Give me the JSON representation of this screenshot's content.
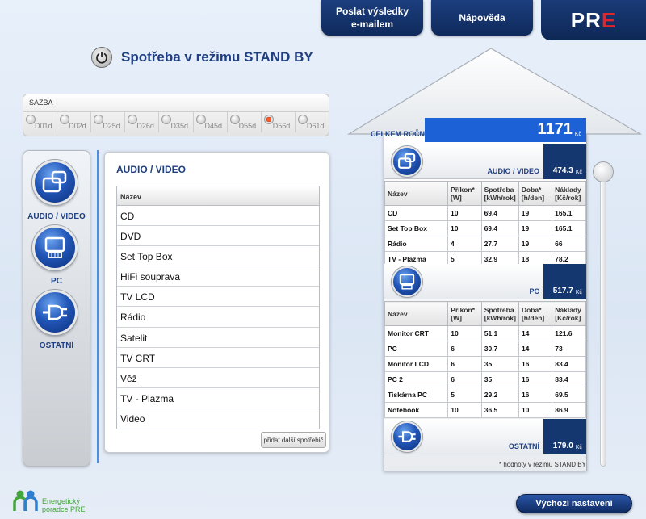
{
  "nav": {
    "email_label": "Poslat výsledky\ne-mailem",
    "help_label": "Nápověda",
    "logo_part1": "PR",
    "logo_part2": "E"
  },
  "header": {
    "title": "Spotřeba v režimu STAND BY"
  },
  "sazba": {
    "label": "SAZBA",
    "options": [
      "D01d",
      "D02d",
      "D25d",
      "D26d",
      "D35d",
      "D45d",
      "D55d",
      "D56d",
      "D61d"
    ],
    "selected": "D56d"
  },
  "categories": [
    {
      "label": "AUDIO / VIDEO",
      "icon": "audio-video-icon"
    },
    {
      "label": "PC",
      "icon": "pc-icon"
    },
    {
      "label": "OSTATNÍ",
      "icon": "plug-icon"
    }
  ],
  "device_panel": {
    "title": "AUDIO / VIDEO",
    "column_header": "Název",
    "items": [
      "CD",
      "DVD",
      "Set Top Box",
      "HiFi souprava",
      "TV LCD",
      "Rádio",
      "Satelit",
      "TV CRT",
      "Věž",
      "TV - Plazma",
      "Video"
    ],
    "add_button": "přidat další spotřebič"
  },
  "house": {
    "total_label": "CELKEM ROČNĚ",
    "total_value": "1171",
    "currency": "Kč",
    "columns": [
      "Název",
      "Příkon*\n[W]",
      "Spotřeba\n[kWh/rok]",
      "Doba*\n[h/den]",
      "Náklady\n[Kč/rok]"
    ],
    "sections": [
      {
        "name": "AUDIO / VIDEO",
        "total": "474.3",
        "rows": [
          [
            "CD",
            "10",
            "69.4",
            "19",
            "165.1"
          ],
          [
            "Set Top Box",
            "10",
            "69.4",
            "19",
            "165.1"
          ],
          [
            "Rádio",
            "4",
            "27.7",
            "19",
            "66"
          ],
          [
            "TV - Plazma",
            "5",
            "32.9",
            "18",
            "78.2"
          ]
        ]
      },
      {
        "name": "PC",
        "total": "517.7",
        "rows": [
          [
            "Monitor CRT",
            "10",
            "51.1",
            "14",
            "121.6"
          ],
          [
            "PC",
            "6",
            "30.7",
            "14",
            "73"
          ],
          [
            "Monitor LCD",
            "6",
            "35",
            "16",
            "83.4"
          ],
          [
            "PC 2",
            "6",
            "35",
            "16",
            "83.4"
          ],
          [
            "Tiskárna PC",
            "5",
            "29.2",
            "16",
            "69.5"
          ],
          [
            "Notebook",
            "10",
            "36.5",
            "10",
            "86.9"
          ]
        ]
      },
      {
        "name": "OSTATNÍ",
        "total": "179.0",
        "rows": []
      }
    ],
    "note": "* hodnoty v režimu STAND BY"
  },
  "footer": {
    "brand_line1": "Energetický",
    "brand_line2": "poradce PRE",
    "reset_label": "Výchozí nastavení"
  },
  "colors": {
    "navy": "#0f2a5c",
    "accent_blue": "#1c62d6",
    "brand_red": "#e0252b",
    "brand_green": "#43a63a"
  }
}
